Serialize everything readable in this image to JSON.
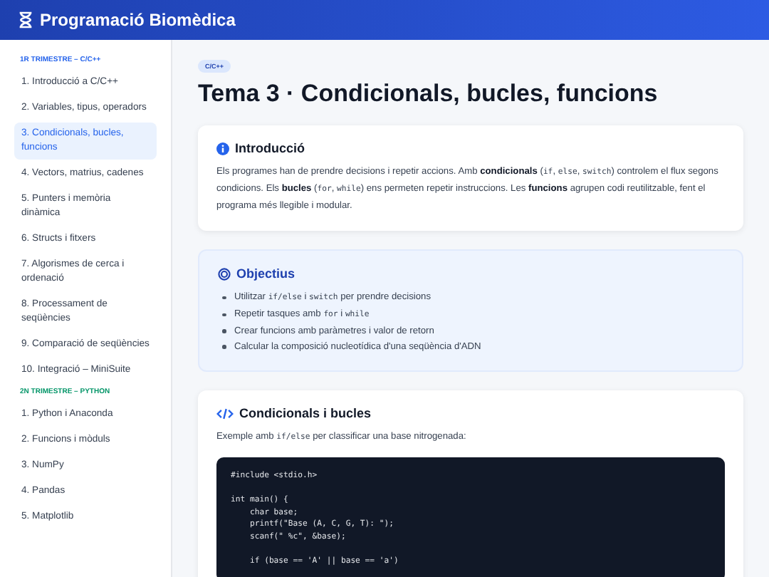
{
  "header": {
    "title": "Programació Biomèdica"
  },
  "sidebar": {
    "sections": [
      {
        "title": "1R TRIMESTRE – C/C++",
        "color": "#2563eb",
        "items": [
          {
            "label": "1. Introducció a C/C++",
            "selected": false
          },
          {
            "label": "2. Variables, tipus, operadors",
            "selected": false
          },
          {
            "label": "3. Condicionals, bucles, funcions",
            "selected": true
          },
          {
            "label": "4. Vectors, matrius, cadenes",
            "selected": false
          },
          {
            "label": "5. Punters i memòria dinàmica",
            "selected": false
          },
          {
            "label": "6. Structs i fitxers",
            "selected": false
          },
          {
            "label": "7. Algorismes de cerca i ordenació",
            "selected": false
          },
          {
            "label": "8. Processament de seqüències",
            "selected": false
          },
          {
            "label": "9. Comparació de seqüències",
            "selected": false
          },
          {
            "label": "10. Integració – MiniSuite",
            "selected": false
          }
        ]
      },
      {
        "title": "2N TRIMESTRE – PYTHON",
        "color": "#059669",
        "items": [
          {
            "label": "1. Python i Anaconda",
            "selected": false
          },
          {
            "label": "2. Funcions i mòduls",
            "selected": false
          },
          {
            "label": "3. NumPy",
            "selected": false
          },
          {
            "label": "4. Pandas",
            "selected": false
          },
          {
            "label": "5. Matplotlib",
            "selected": false
          }
        ]
      }
    ]
  },
  "main": {
    "badge": "C/C++",
    "title": "Tema 3 · Condicionals, bucles, funcions",
    "intro": {
      "heading": "Introducció",
      "text": [
        {
          "kind": "text",
          "text": "Els programes han de prendre decisions i repetir accions. Amb "
        },
        {
          "kind": "bold",
          "text": "condicionals"
        },
        {
          "kind": "text",
          "text": " ("
        },
        {
          "kind": "code",
          "text": "if"
        },
        {
          "kind": "text",
          "text": ", "
        },
        {
          "kind": "code",
          "text": "else"
        },
        {
          "kind": "text",
          "text": ", "
        },
        {
          "kind": "code",
          "text": "switch"
        },
        {
          "kind": "text",
          "text": ") controlem el flux segons condicions. Els "
        },
        {
          "kind": "bold",
          "text": "bucles"
        },
        {
          "kind": "text",
          "text": " ("
        },
        {
          "kind": "code",
          "text": "for"
        },
        {
          "kind": "text",
          "text": ", "
        },
        {
          "kind": "code",
          "text": "while"
        },
        {
          "kind": "text",
          "text": ") ens permeten repetir instruccions. Les "
        },
        {
          "kind": "bold",
          "text": "funcions"
        },
        {
          "kind": "text",
          "text": " agrupen codi reutilitzable, fent el programa més llegible i modular."
        }
      ]
    },
    "objectives": {
      "heading": "Objectius",
      "items": [
        [
          {
            "kind": "text",
            "text": "Utilitzar "
          },
          {
            "kind": "code",
            "text": "if/else"
          },
          {
            "kind": "text",
            "text": " i "
          },
          {
            "kind": "code",
            "text": "switch"
          },
          {
            "kind": "text",
            "text": " per prendre decisions"
          }
        ],
        [
          {
            "kind": "text",
            "text": "Repetir tasques amb "
          },
          {
            "kind": "code",
            "text": "for"
          },
          {
            "kind": "text",
            "text": " i "
          },
          {
            "kind": "code",
            "text": "while"
          }
        ],
        [
          {
            "kind": "text",
            "text": "Crear funcions amb paràmetres i valor de retorn"
          }
        ],
        [
          {
            "kind": "text",
            "text": "Calcular la composició nucleotídica d'una seqüència d'ADN"
          }
        ]
      ]
    },
    "example": {
      "heading": "Condicionals i bucles",
      "text": [
        {
          "kind": "text",
          "text": "Exemple amb "
        },
        {
          "kind": "code",
          "text": "if/else"
        },
        {
          "kind": "text",
          "text": " per classificar una base nitrogenada:"
        }
      ],
      "code": [
        [
          "#include <stdio.h>"
        ],
        [
          "int main() {",
          "    char base;",
          "    printf(\"Base (A, C, G, T): \");",
          "    scanf(\" %c\", &base);"
        ],
        [
          "    if (base == 'A' || base == 'a')"
        ]
      ]
    }
  }
}
